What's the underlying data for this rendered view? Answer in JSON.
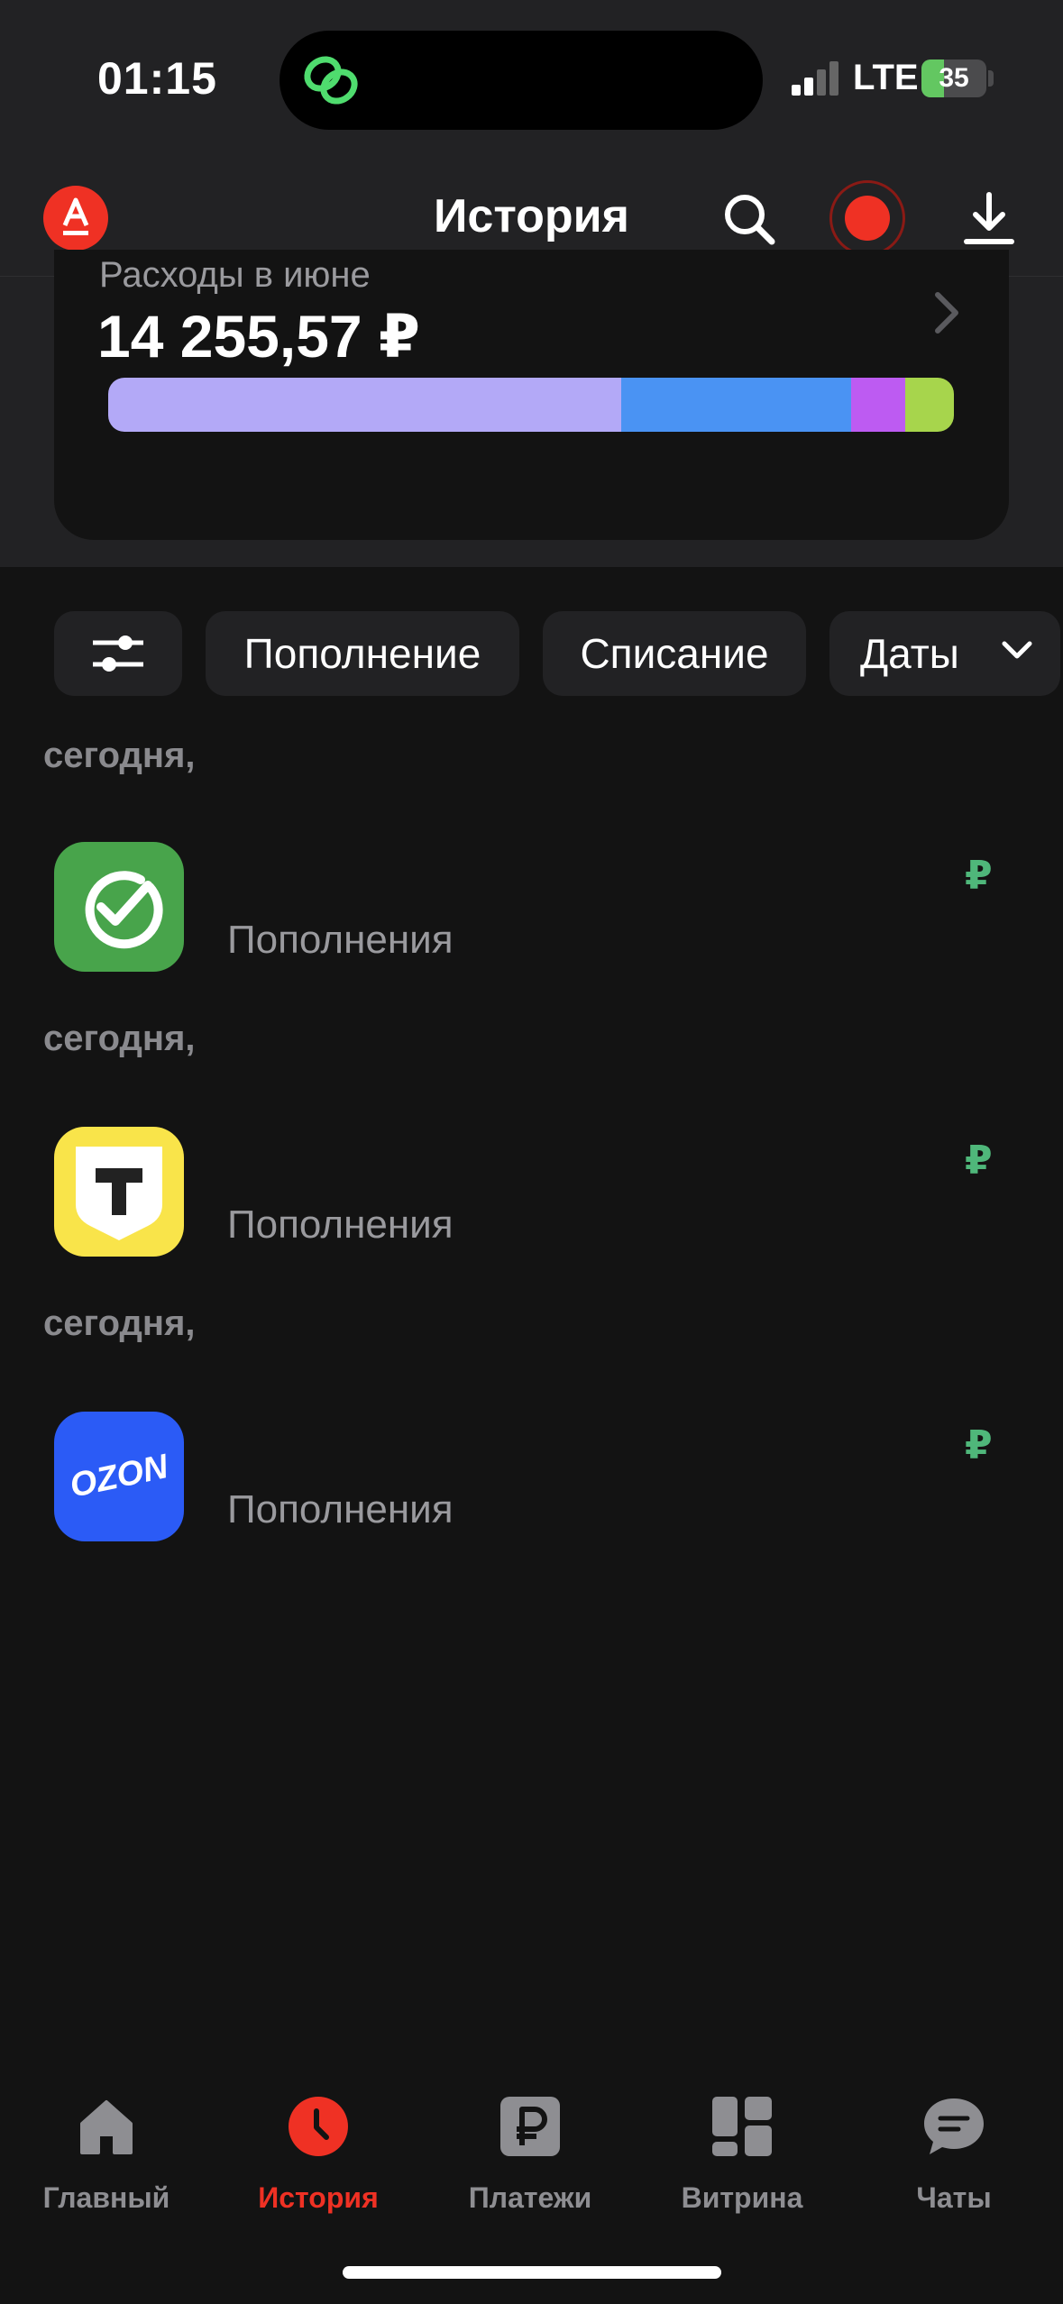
{
  "status_bar": {
    "time": "01:15",
    "network": "LTE",
    "battery": "35",
    "battery_level": 0.35
  },
  "header": {
    "title": "История"
  },
  "summary": {
    "label": "Расходы в июне",
    "amount": "14 255,57 ₽",
    "breakdown_colors": [
      "#b3a9f7",
      "#4a93f3",
      "#bd5bf2",
      "#a7d54c"
    ],
    "breakdown_shares": [
      0.607,
      0.272,
      0.063,
      0.058
    ]
  },
  "filters": {
    "settings_icon": "sliders-icon",
    "chips": [
      "Пополнение",
      "Списание",
      "Даты"
    ]
  },
  "transactions": [
    {
      "date": "сегодня,",
      "merchant": "sber",
      "category": "Пополнения",
      "amount": "₽",
      "icon": "sber-check-icon"
    },
    {
      "date": "сегодня,",
      "merchant": "tbank",
      "category": "Пополнения",
      "amount": "₽",
      "icon": "tbank-shield-icon"
    },
    {
      "date": "сегодня,",
      "merchant": "ozon",
      "category": "Пополнения",
      "amount": "₽",
      "icon": "ozon-logo",
      "logo_text": "OZON"
    }
  ],
  "tabbar": {
    "items": [
      {
        "label": "Главный",
        "icon": "home-icon"
      },
      {
        "label": "История",
        "icon": "clock-icon",
        "active": true
      },
      {
        "label": "Платежи",
        "icon": "ruble-icon"
      },
      {
        "label": "Витрина",
        "icon": "grid-icon"
      },
      {
        "label": "Чаты",
        "icon": "chat-icon"
      }
    ]
  },
  "colors": {
    "accent": "#ef3124",
    "background": "#131313",
    "surface": "#222224",
    "income": "#4fb77a"
  }
}
